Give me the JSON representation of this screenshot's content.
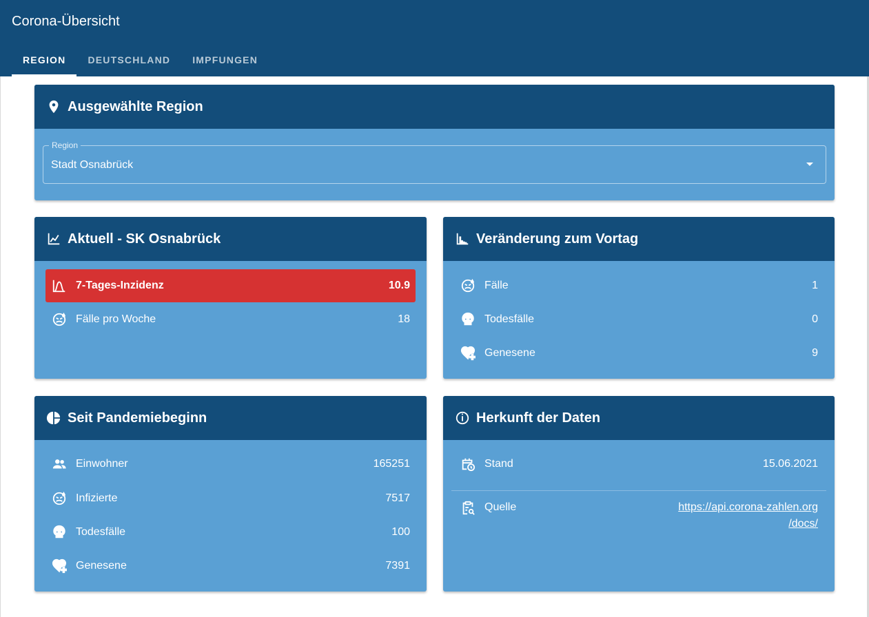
{
  "app": {
    "title": "Corona-Übersicht"
  },
  "tabs": [
    {
      "label": "REGION",
      "active": true
    },
    {
      "label": "DEUTSCHLAND",
      "active": false
    },
    {
      "label": "IMPFUNGEN",
      "active": false
    }
  ],
  "region_card": {
    "title": "Ausgewählte Region",
    "icon": "map-marker-icon",
    "select": {
      "label": "Region",
      "value": "Stadt Osnabrück"
    }
  },
  "current_card": {
    "title": "Aktuell - SK Osnabrück",
    "icon": "chart-line-icon",
    "rows": [
      {
        "label": "7-Tages-Inzidenz",
        "value": "10.9",
        "icon": "bell-curve-icon",
        "highlight_color": "#d63232"
      },
      {
        "label": "Fälle pro Woche",
        "value": "18",
        "icon": "emoticon-sick-icon"
      }
    ]
  },
  "change_card": {
    "title": "Veränderung zum Vortag",
    "icon": "chart-bar-icon",
    "rows": [
      {
        "label": "Fälle",
        "value": "1",
        "icon": "emoticon-sick-icon"
      },
      {
        "label": "Todesfälle",
        "value": "0",
        "icon": "skull-icon"
      },
      {
        "label": "Genesene",
        "value": "9",
        "icon": "heart-plus-icon"
      }
    ]
  },
  "total_card": {
    "title": "Seit Pandemiebeginn",
    "icon": "chart-pie-icon",
    "rows": [
      {
        "label": "Einwohner",
        "value": "165251",
        "icon": "account-group-icon"
      },
      {
        "label": "Infizierte",
        "value": "7517",
        "icon": "emoticon-sick-icon"
      },
      {
        "label": "Todesfälle",
        "value": "100",
        "icon": "skull-icon"
      },
      {
        "label": "Genesene",
        "value": "7391",
        "icon": "heart-plus-icon"
      }
    ]
  },
  "source_card": {
    "title": "Herkunft der Daten",
    "icon": "information-icon",
    "stand": {
      "label": "Stand",
      "value": "15.06.2021",
      "icon": "calendar-clock-icon"
    },
    "quelle": {
      "label": "Quelle",
      "line1": "https://api.corona-zahlen.org",
      "line2": "/docs/",
      "icon": "clipboard-search-icon"
    }
  },
  "colors": {
    "appbar": "#134d7a",
    "card_body": "#5aa0d4",
    "highlight": "#d63232"
  }
}
